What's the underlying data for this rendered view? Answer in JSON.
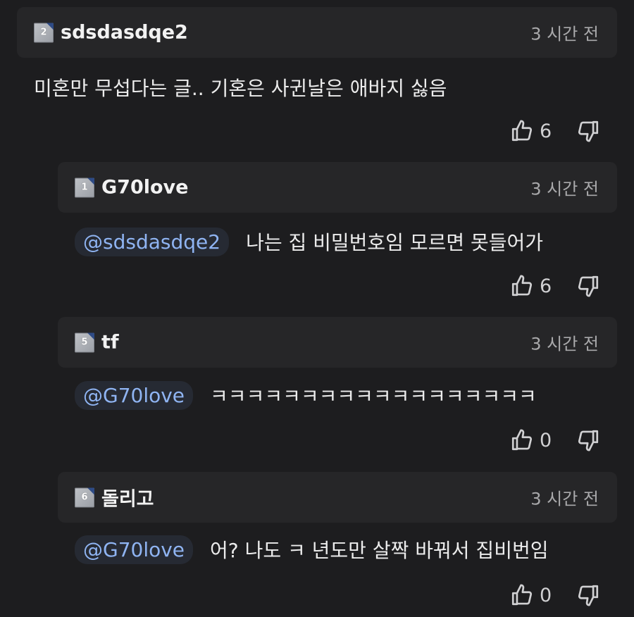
{
  "comments": [
    {
      "level": "2",
      "username": "sdsdasdqe2",
      "time": "3 시간 전",
      "mention": "",
      "text": "미혼만 무섭다는 글.. 기혼은 사귄날은 애바지 싫음",
      "likes": "6"
    },
    {
      "level": "1",
      "username": "G70love",
      "time": "3 시간 전",
      "mention": "@sdsdasdqe2",
      "text": "나는 집 비밀번호임 모르면 못들어가",
      "likes": "6"
    },
    {
      "level": "5",
      "username": "tf",
      "time": "3 시간 전",
      "mention": "@G70love",
      "text": "ㅋㅋㅋㅋㅋㅋㅋㅋㅋㅋㅋㅋㅋㅋㅋㅋㅋㅋ",
      "likes": "0"
    },
    {
      "level": "6",
      "username": "돌리고",
      "time": "3 시간 전",
      "mention": "@G70love",
      "text": "어? 나도 ㅋ 년도만 살짝 바꿔서 집비번임",
      "likes": "0"
    }
  ],
  "icons": {
    "like": "thumbs-up-icon",
    "dislike": "thumbs-down-icon"
  },
  "colors": {
    "background": "#1d1d1f",
    "header_background": "#262628",
    "mention_text": "#8fb4f2",
    "mention_background": "#262a33",
    "badge_corner": "#2e4b86"
  }
}
